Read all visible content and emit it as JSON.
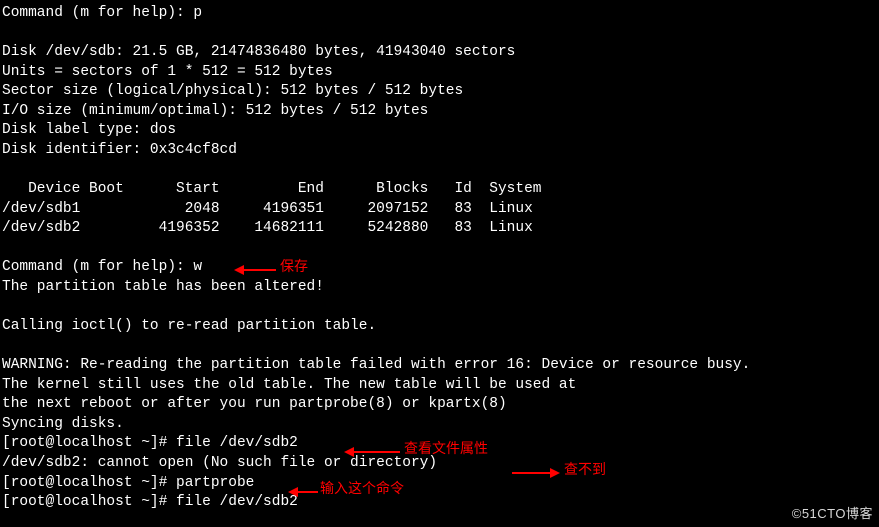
{
  "cmd_prompt1": "Command (m for help): p",
  "disk_info": {
    "line1": "Disk /dev/sdb: 21.5 GB, 21474836480 bytes, 41943040 sectors",
    "line2": "Units = sectors of 1 * 512 = 512 bytes",
    "line3": "Sector size (logical/physical): 512 bytes / 512 bytes",
    "line4": "I/O size (minimum/optimal): 512 bytes / 512 bytes",
    "line5": "Disk label type: dos",
    "line6": "Disk identifier: 0x3c4cf8cd"
  },
  "table_header": "   Device Boot      Start         End      Blocks   Id  System",
  "table_rows": [
    "/dev/sdb1            2048     4196351     2097152   83  Linux",
    "/dev/sdb2         4196352    14682111     5242880   83  Linux"
  ],
  "cmd_prompt2": "Command (m for help): w",
  "altered": "The partition table has been altered!",
  "ioctl": "Calling ioctl() to re-read partition table.",
  "warn1": "WARNING: Re-reading the partition table failed with error 16: Device or resource busy.",
  "warn2": "The kernel still uses the old table. The new table will be used at",
  "warn3": "the next reboot or after you run partprobe(8) or kpartx(8)",
  "sync": "Syncing disks.",
  "prompt_lines": {
    "p1": "[root@localhost ~]# file /dev/sdb2",
    "p2": "/dev/sdb2: cannot open (No such file or directory)",
    "p3": "[root@localhost ~]# partprobe",
    "p4": "[root@localhost ~]# file /dev/sdb2"
  },
  "annotations": {
    "save": "保存",
    "view_attr": "查看文件属性",
    "not_found": "查不到",
    "input_cmd": "输入这个命令"
  },
  "watermark": "©51CTO博客"
}
